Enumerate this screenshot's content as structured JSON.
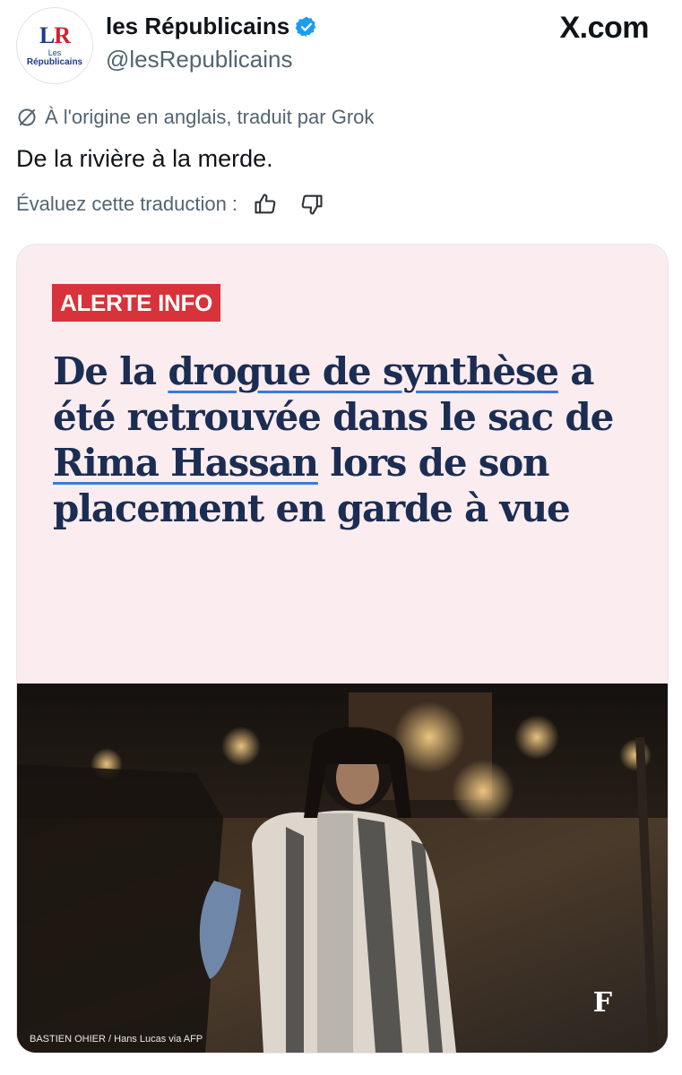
{
  "header": {
    "avatar_mono_l": "L",
    "avatar_mono_r": "R",
    "avatar_line1": "Les",
    "avatar_line2": "Républicains",
    "display_name": "les Républicains",
    "handle": "@lesRepublicains",
    "site": "X.com"
  },
  "translation": {
    "note": "À l'origine en anglais, traduit par Grok",
    "text": "De la rivière à la merde.",
    "rate_label": "Évaluez cette traduction :"
  },
  "card": {
    "badge": "ALERTE INFO",
    "headline": {
      "p1": "De la ",
      "u1": "drogue de synthèse",
      "p2": " a été retrouvée dans le sac de ",
      "u2": "Rima Hassan",
      "p3": " lors de son placement en garde à vue"
    },
    "photo_credit": "BASTIEN OHIER / Hans Lucas via AFP",
    "logo_mark": "F"
  },
  "colors": {
    "verified": "#1d9bf0",
    "badge": "#d8323a",
    "headline": "#1b2d52",
    "card_bg": "#fbecef",
    "muted": "#536471"
  },
  "icons": [
    "verified-badge-icon",
    "translate-icon",
    "thumbs-up-icon",
    "thumbs-down-icon",
    "figaro-logo-icon"
  ]
}
